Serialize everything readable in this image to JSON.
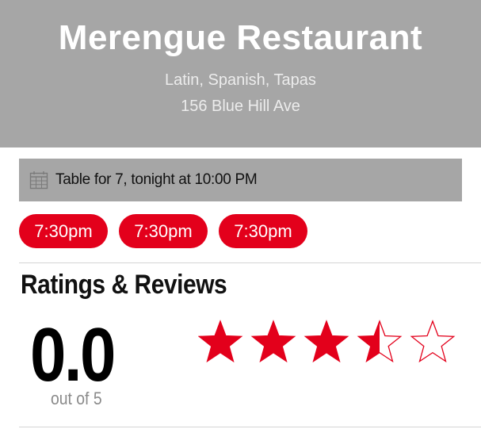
{
  "restaurant": {
    "name": "Merengue Restaurant",
    "cuisine": "Latin, Spanish, Tapas",
    "address": "156 Blue Hill Ave"
  },
  "reservation": {
    "icon": "calendar-icon",
    "summary": "Table for 7, tonight at 10:00 PM"
  },
  "time_slots": [
    {
      "label": "7:30pm"
    },
    {
      "label": "7:30pm"
    },
    {
      "label": "7:30pm"
    }
  ],
  "ratings": {
    "title": "Ratings & Reviews",
    "score": "0.0",
    "scale_label": "out of 5",
    "stars_filled": 3.5,
    "stars_total": 5
  },
  "colors": {
    "accent": "#e3001b",
    "header_bg": "#a6a6a6",
    "subtle_text": "#8a8a8a"
  }
}
